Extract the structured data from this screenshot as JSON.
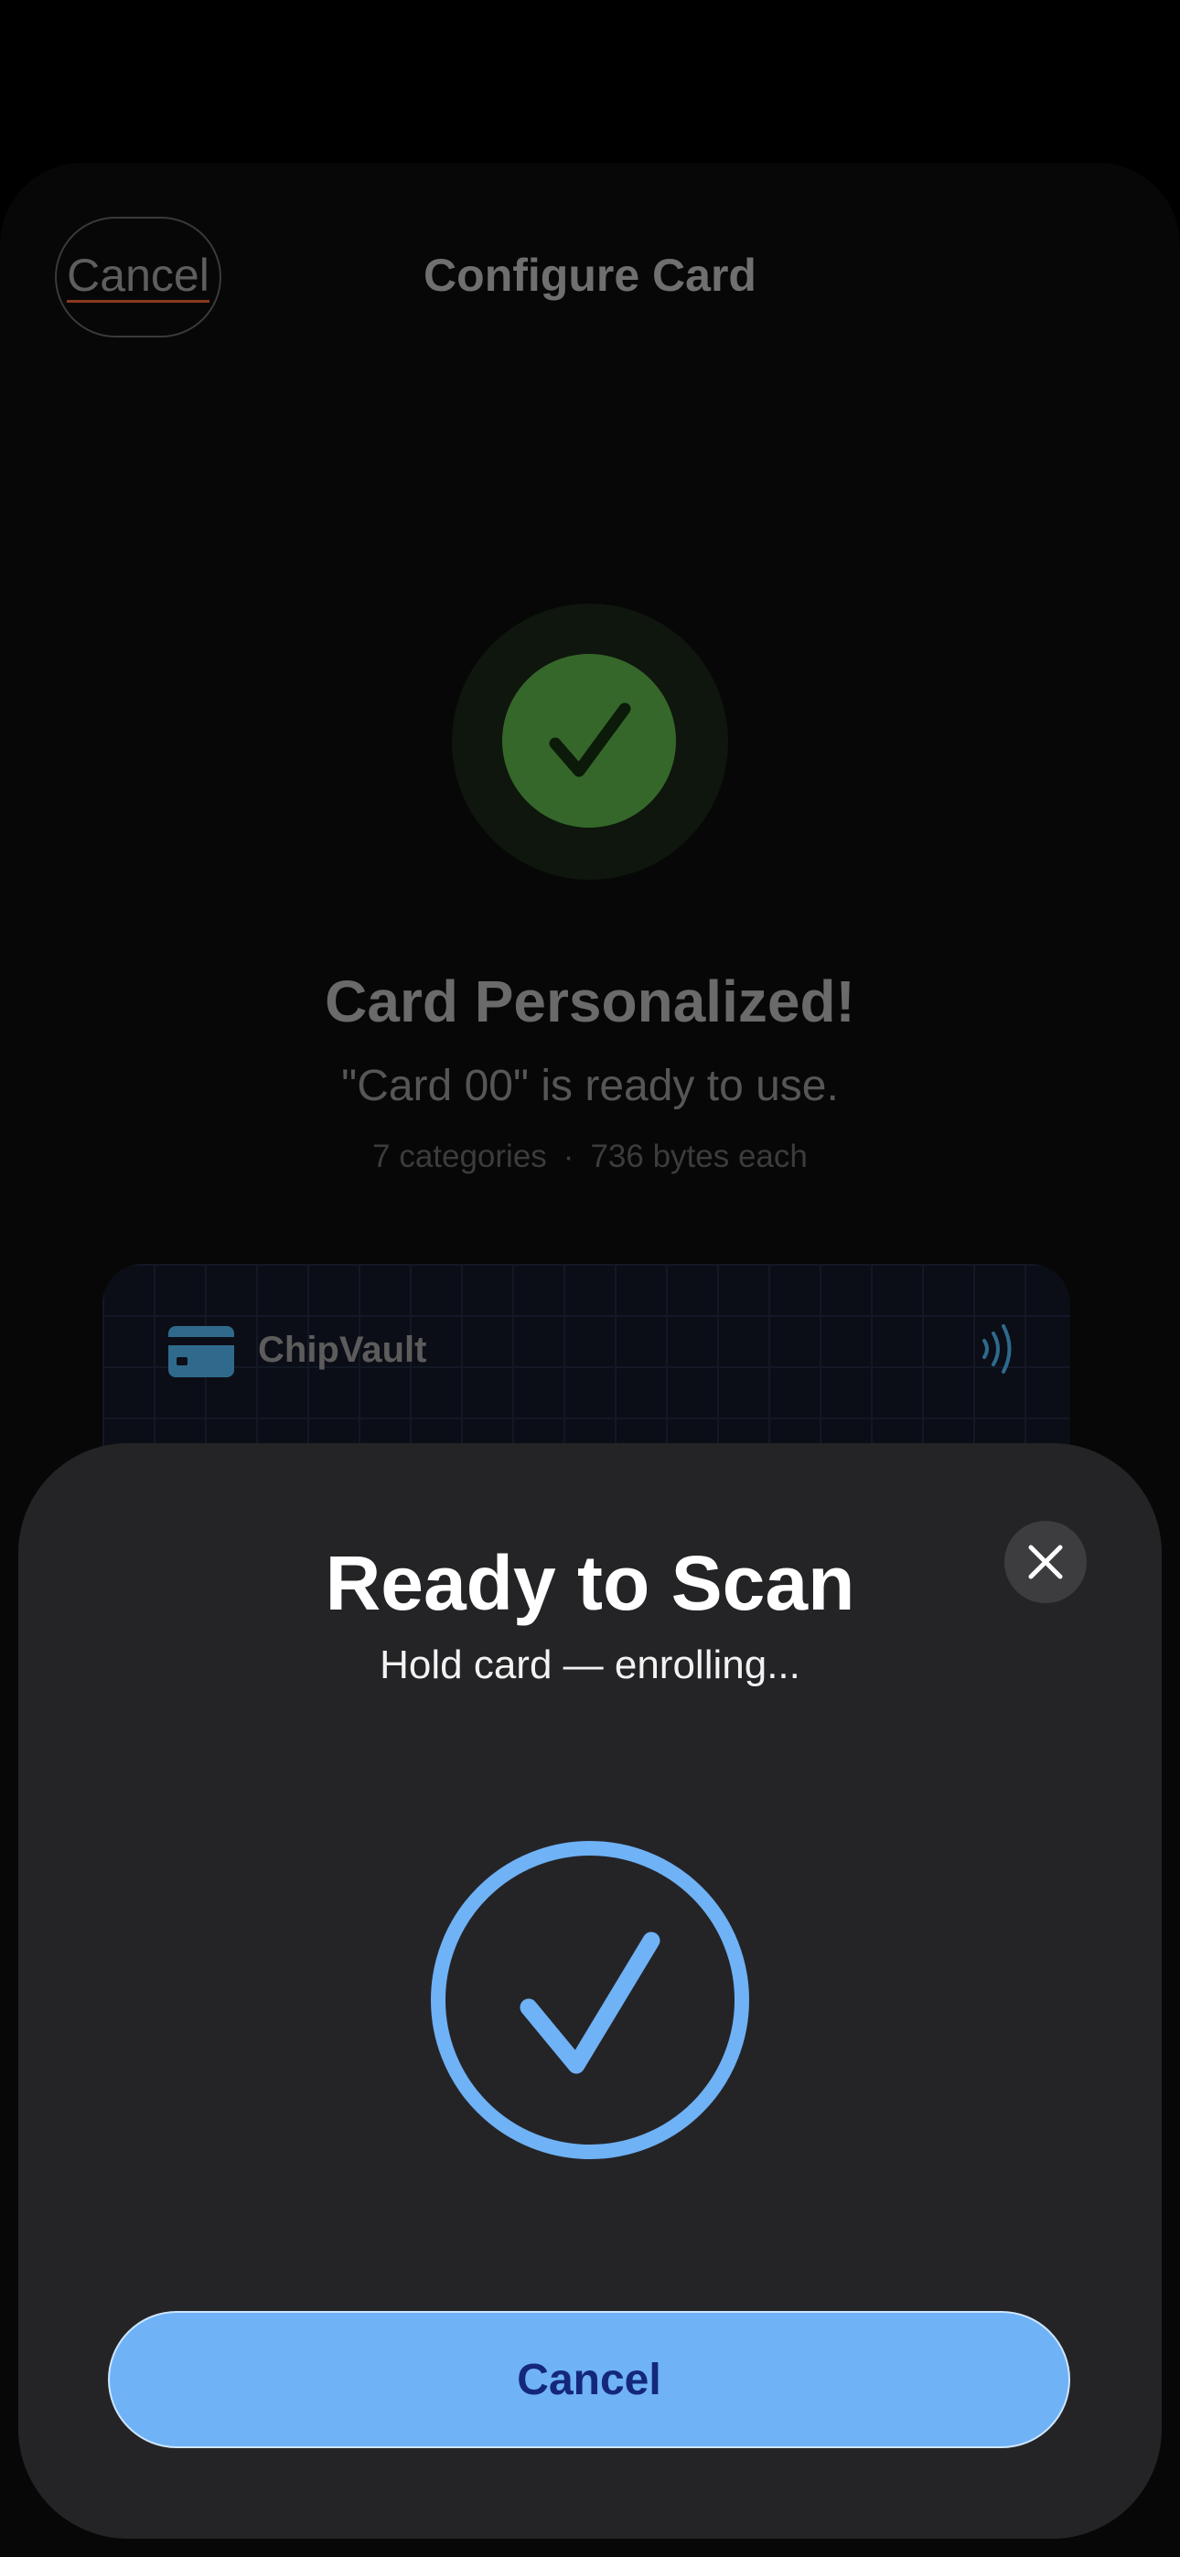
{
  "background": {
    "cancel_label": "Cancel",
    "title": "Configure Card",
    "heading": "Card Personalized!",
    "subtitle": "\"Card 00\" is ready to use.",
    "meta": {
      "categories": "7 categories",
      "separator": "·",
      "bytes": "736 bytes each"
    },
    "card": {
      "brand": "ChipVault",
      "logo_icon": "credit-card-icon",
      "contactless_icon": "contactless-icon"
    },
    "success_icon": "checkmark-icon"
  },
  "scan_sheet": {
    "title": "Ready to Scan",
    "subtitle": "Hold card — enrolling...",
    "close_icon": "close-icon",
    "status_icon": "checkmark-circle-icon",
    "cancel_label": "Cancel"
  },
  "colors": {
    "accent_blue": "#6fb2f6",
    "success_green": "#35672a",
    "sheet_bg": "#242427"
  }
}
